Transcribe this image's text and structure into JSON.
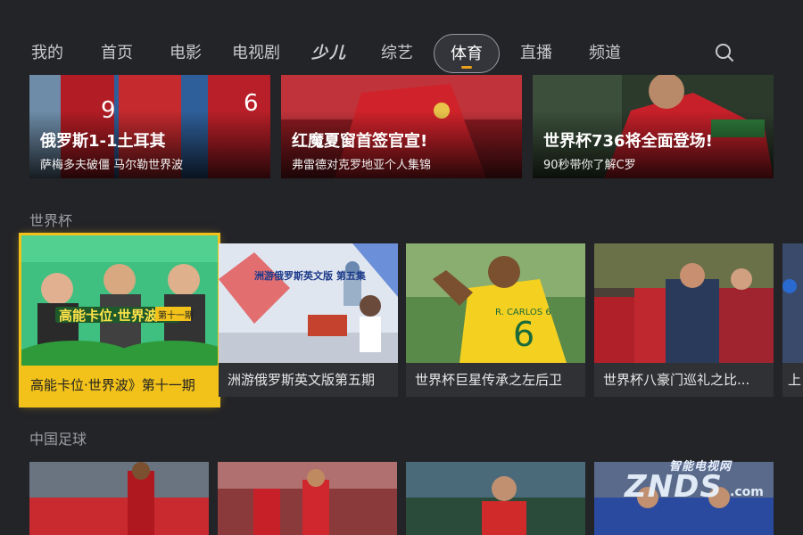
{
  "nav": {
    "items": [
      {
        "label": "我的"
      },
      {
        "label": "首页"
      },
      {
        "label": "电影"
      },
      {
        "label": "电视剧"
      },
      {
        "label": "少儿"
      },
      {
        "label": "综艺"
      },
      {
        "label": "体育"
      },
      {
        "label": "直播"
      },
      {
        "label": "频道"
      }
    ],
    "active": "体育"
  },
  "top_row": [
    {
      "title": "俄罗斯1-1土耳其",
      "subtitle": "萨梅多夫破僵 马尔勒世界波"
    },
    {
      "title": "红魔夏窗首签官宣!",
      "subtitle": "弗雷德对克罗地亚个人集锦"
    },
    {
      "title": "世界杯736将全面登场!",
      "subtitle": "90秒带你了解C罗"
    }
  ],
  "sections": {
    "worldcup": {
      "title": "世界杯",
      "items": [
        {
          "caption": "高能卡位·世界波》第十一期",
          "thumb_text": "高能卡位·世界波",
          "badge": "第十一期"
        },
        {
          "caption": "洲游俄罗斯英文版第五期",
          "thumb_text": "洲游俄罗斯英文版 第五集"
        },
        {
          "caption": "世界杯巨星传承之左后卫",
          "jersey": "R. CARLOS 6"
        },
        {
          "caption": "世界杯八豪门巡礼之比..."
        },
        {
          "caption": "上"
        }
      ]
    },
    "chinese_football": {
      "title": "中国足球",
      "items": [
        {},
        {},
        {},
        {}
      ]
    }
  },
  "watermark": {
    "top": "智能电视网",
    "main": "ZNDS",
    "suffix": ".com"
  },
  "colors": {
    "background": "#232428",
    "focus": "#f2c21a",
    "active_indicator": "#e8a01a"
  }
}
